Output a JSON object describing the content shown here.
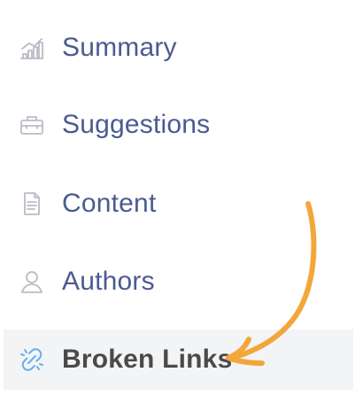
{
  "sidebar": {
    "items": [
      {
        "label": "Summary",
        "icon": "bar-chart-icon"
      },
      {
        "label": "Suggestions",
        "icon": "toolbox-icon"
      },
      {
        "label": "Content",
        "icon": "document-icon"
      },
      {
        "label": "Authors",
        "icon": "user-icon"
      },
      {
        "label": "Broken Links",
        "icon": "broken-link-icon",
        "active": true
      }
    ]
  },
  "colors": {
    "menu_text": "#4b5a92",
    "active_text": "#4a4a4a",
    "active_background": "#f3f4f6",
    "icon": "#b9bcc6",
    "active_icon": "#6aaee8",
    "annotation_arrow": "#f2a73a"
  }
}
